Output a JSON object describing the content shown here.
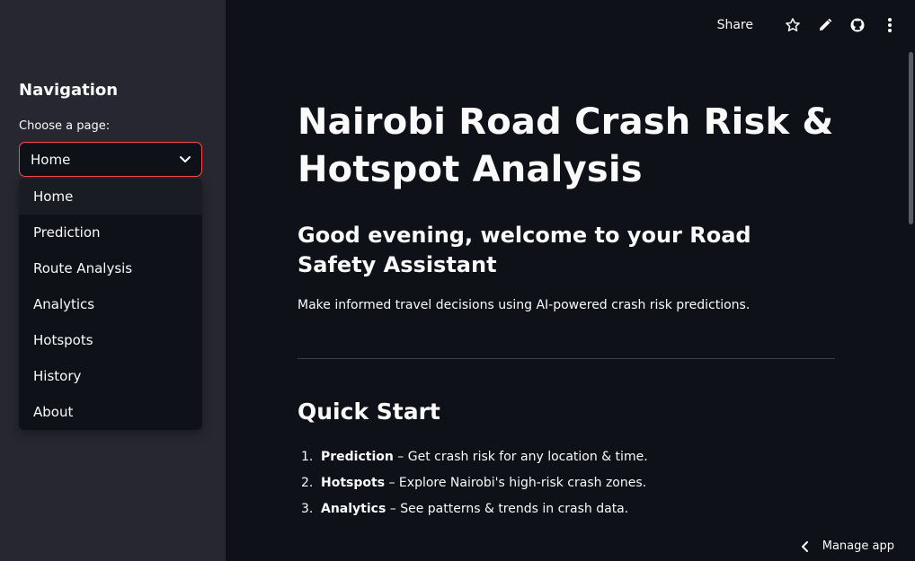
{
  "sidebar": {
    "title": "Navigation",
    "select_label": "Choose a page:",
    "selected": "Home",
    "options": [
      "Home",
      "Prediction",
      "Route Analysis",
      "Analytics",
      "Hotspots",
      "History",
      "About"
    ]
  },
  "toolbar": {
    "share_label": "Share",
    "icons": [
      "star-icon",
      "pencil-icon",
      "github-icon",
      "kebab-menu-icon"
    ]
  },
  "main": {
    "title": "Nairobi Road Crash Risk & Hotspot Analysis",
    "subtitle": "Good evening, welcome to your Road Safety Assistant",
    "intro": "Make informed travel decisions using AI-powered crash risk predictions.",
    "section_title": "Quick Start",
    "steps": [
      {
        "num": "1.",
        "bold": "Prediction",
        "text": " – Get crash risk for any location & time."
      },
      {
        "num": "2.",
        "bold": "Hotspots",
        "text": " – Explore Nairobi's high-risk crash zones."
      },
      {
        "num": "3.",
        "bold": "Analytics",
        "text": " – See patterns & trends in crash data."
      }
    ]
  },
  "footer": {
    "manage_label": "Manage app"
  },
  "colors": {
    "accent": "#ff4b4b",
    "sidebar_bg": "#262730",
    "main_bg": "#0e1117"
  }
}
